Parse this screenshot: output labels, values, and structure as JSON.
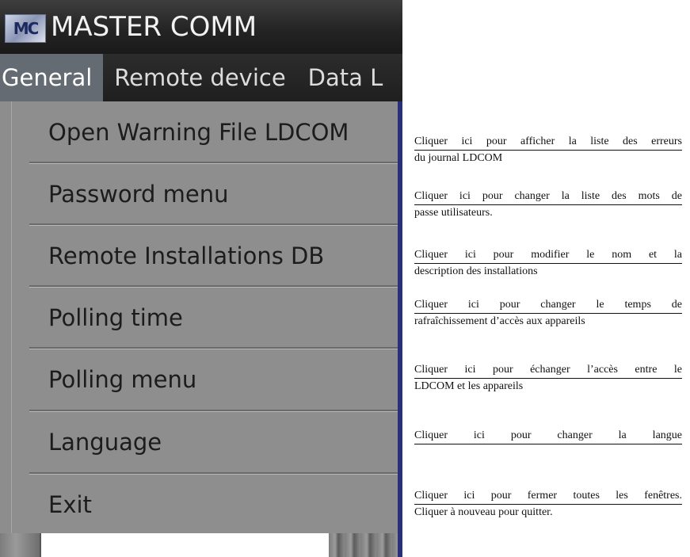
{
  "window": {
    "logo_text": "MC",
    "title": "MASTER COMM"
  },
  "menubar": {
    "items": [
      {
        "label": "General",
        "active": true
      },
      {
        "label": "Remote device",
        "active": false
      },
      {
        "label": "Data L",
        "active": false
      }
    ]
  },
  "dropdown": {
    "items": [
      {
        "label": "Open Warning File LDCOM"
      },
      {
        "label": "Password menu"
      },
      {
        "label": "Remote Installations DB"
      },
      {
        "label": "Polling time"
      },
      {
        "label": "Polling menu"
      },
      {
        "label": "Language"
      },
      {
        "label": "Exit"
      }
    ]
  },
  "annotations": [
    {
      "line1": "Cliquer ici pour afficher la liste des erreurs",
      "line2": "du journal LDCOM"
    },
    {
      "line1": "Cliquer ici pour changer la liste des mots de",
      "line2": "passe utilisateurs."
    },
    {
      "line1": "Cliquer ici pour modifier le nom et la",
      "line2": "description des installations"
    },
    {
      "line1": "Cliquer ici pour changer le temps de",
      "line2": "rafraîchissement d’accès aux appareils"
    },
    {
      "line1": "Cliquer ici pour échanger l’accès entre le",
      "line2": "LDCOM et les appareils"
    },
    {
      "line1": "Cliquer ici pour changer la langue",
      "line2": ""
    },
    {
      "line1": "Cliquer ici pour fermer toutes les fenêtres.",
      "line2": "Cliquer à nouveau pour quitter."
    }
  ],
  "colors": {
    "menu_background": "#8e8e8e",
    "menubar_background": "#1f1f1f",
    "active_menu": "#656b72"
  }
}
